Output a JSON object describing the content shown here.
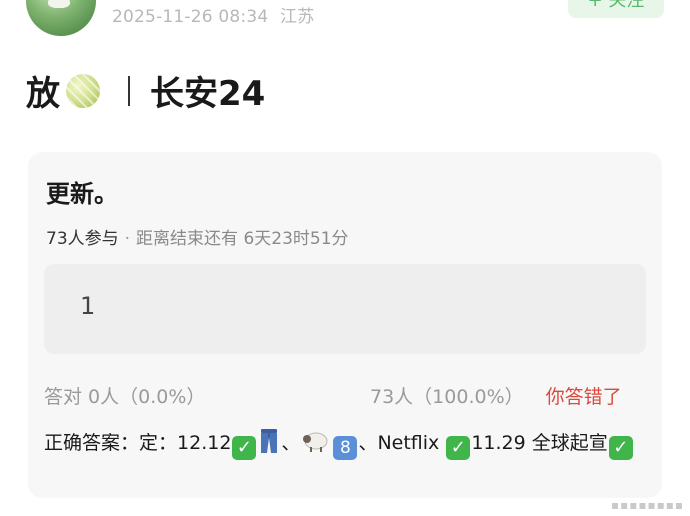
{
  "header": {
    "timestamp": "2025-11-26 08:34",
    "location": "江苏",
    "follow_label": "+ 关注"
  },
  "post": {
    "title_prefix": "放",
    "melon_icon": "melon-icon",
    "title_suffix": "长安24"
  },
  "poll": {
    "title": "更新。",
    "participants": "73人参与",
    "dot": "·",
    "remaining": "距离结束还有 6天23时51分",
    "option": "1",
    "correct_stat": "答对 0人（0.0%）",
    "wrong_stat": "73人（100.0%）",
    "wrong_label": "你答错了",
    "answer_label": "正确答案：",
    "answer_part1": "定：12.12",
    "answer_sep1": "、",
    "answer_sep2": "、Netflix ",
    "answer_part2": "11.29 全球起宣",
    "eight_glyph": "8"
  },
  "colors": {
    "accent_green": "#57b96a",
    "wrong_red": "#d94a3d"
  }
}
